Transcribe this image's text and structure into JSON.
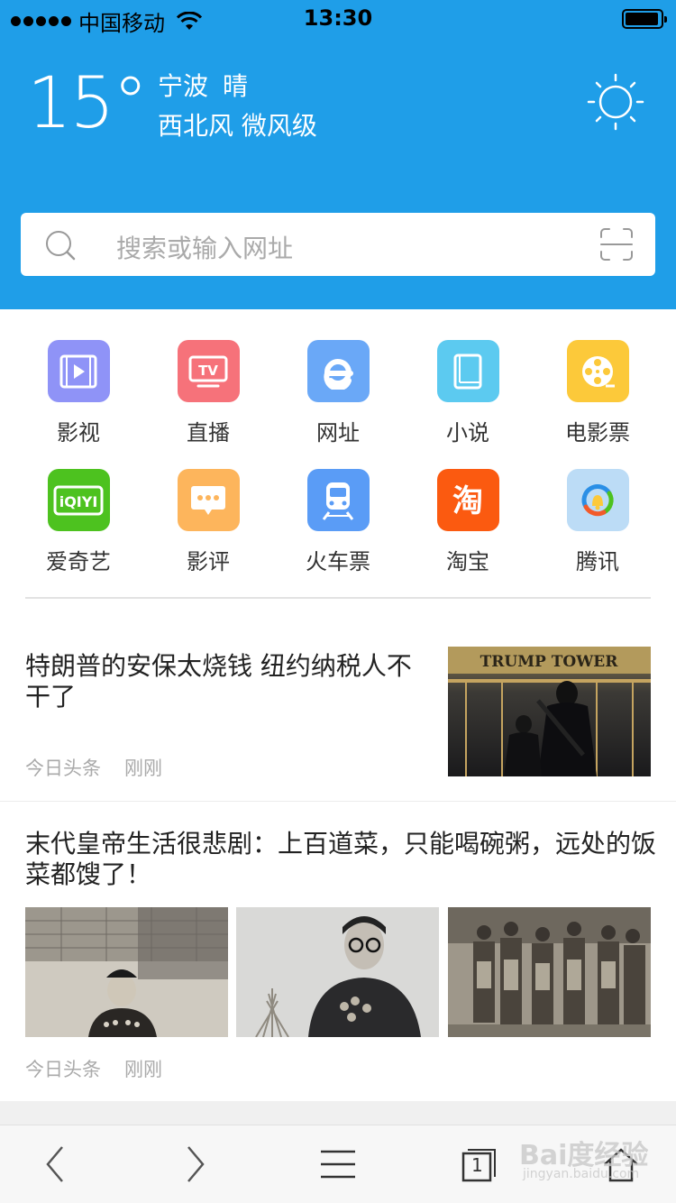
{
  "status_bar": {
    "carrier": "中国移动",
    "time": "13:30"
  },
  "weather": {
    "temperature": "15°",
    "city": "宁波",
    "condition": "晴",
    "wind": "西北风 微风级",
    "icon": "sun-icon"
  },
  "search": {
    "placeholder": "搜索或输入网址",
    "icon": "search-icon",
    "scan_icon": "scan-icon"
  },
  "apps": [
    {
      "label": "影视",
      "icon": "video-icon",
      "color": "#8f93f7"
    },
    {
      "label": "直播",
      "icon": "tv-icon",
      "color": "#f6727a"
    },
    {
      "label": "网址",
      "icon": "e-browser-icon",
      "color": "#6aa8f7"
    },
    {
      "label": "小说",
      "icon": "book-icon",
      "color": "#5ccaf0"
    },
    {
      "label": "电影票",
      "icon": "film-reel-icon",
      "color": "#fcc93a"
    },
    {
      "label": "爱奇艺",
      "icon": "iqiyi-icon",
      "color": "#4dc21f",
      "badge": "iQIYI"
    },
    {
      "label": "影评",
      "icon": "comment-icon",
      "color": "#fdb55c"
    },
    {
      "label": "火车票",
      "icon": "train-icon",
      "color": "#5a9cf6"
    },
    {
      "label": "淘宝",
      "icon": "taobao-icon",
      "color": "#fb5a10",
      "badge": "淘"
    },
    {
      "label": "腾讯",
      "icon": "tencent-icon",
      "color": "#bcdcf6"
    }
  ],
  "news": [
    {
      "title": "特朗普的安保太烧钱 纽约纳税人不干了",
      "source": "今日头条",
      "time": "刚刚",
      "image_caption": "TRUMP TOWER"
    },
    {
      "title": "末代皇帝生活很悲剧：上百道菜，只能喝碗粥，远处的饭菜都馊了！",
      "source": "今日头条",
      "time": "刚刚"
    }
  ],
  "toolbar": {
    "back_icon": "chevron-left-icon",
    "forward_icon": "chevron-right-icon",
    "menu_icon": "menu-icon",
    "tabs_count": "1",
    "home_icon": "home-icon"
  },
  "watermark": {
    "text": "Bai度经验",
    "sub": "jingyan.baidu.com"
  }
}
